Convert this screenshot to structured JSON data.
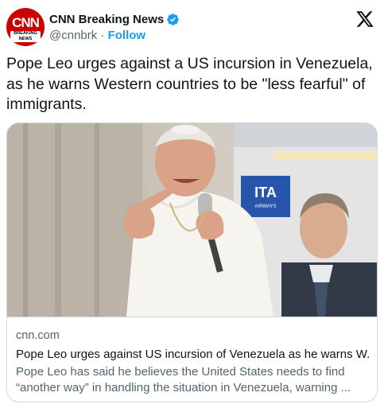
{
  "account": {
    "name": "CNN Breaking News",
    "handle": "@cnnbrk",
    "separator": " · ",
    "follow_label": "Follow",
    "avatar_logo": "CNN",
    "avatar_sub": "BREAKING NEWS",
    "verified": true
  },
  "tweet": {
    "text": "Pope Leo urges against a US incursion in Venezuela, as he warns Western countries to be \"less fearful\" of immigrants."
  },
  "card": {
    "domain": "cnn.com",
    "title": "Pope Leo urges against US incursion of Venezuela as he warns W...",
    "description": "Pope Leo has said he believes the United States needs to find “another way” in handling the situation in Venezuela, warning ...",
    "image_sign_text": "ITA",
    "image_sign_subtext": "AIRWAYS"
  },
  "colors": {
    "text_primary": "#0f1419",
    "text_secondary": "#536471",
    "accent": "#1d9bf0",
    "border": "#cfd9de",
    "brand_red": "#cc0000"
  },
  "icons": {
    "verified": "verified-badge-icon",
    "platform": "x-logo-icon"
  }
}
